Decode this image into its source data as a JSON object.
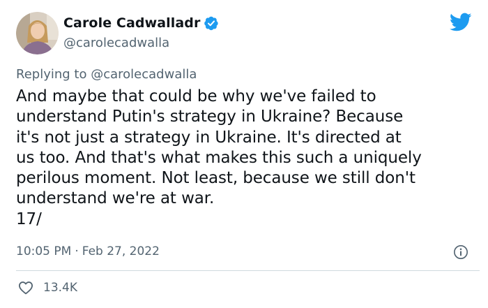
{
  "author": {
    "name": "Carole Cadwalladr",
    "handle": "@carolecadwalla"
  },
  "reply": {
    "prefix": "Replying to",
    "mention": "@carolecadwalla"
  },
  "tweet": {
    "text": "And maybe that could be why we've failed to\nunderstand Putin's strategy in Ukraine? Because\nit's not just a strategy in Ukraine. It's directed at\nus too. And that's what makes this such a uniquely\nperilous moment. Not least, because we still don't\nunderstand we're at war.\n17/",
    "time": "10:05 PM",
    "separator": "·",
    "date": "Feb 27, 2022"
  },
  "stats": {
    "likes": "13.4K"
  },
  "icons": {
    "verified": "verified-badge-icon",
    "brand": "twitter-bird-icon",
    "info": "info-icon",
    "like": "heart-icon"
  },
  "colors": {
    "brand": "#1d9bf0",
    "text": "#0f1419",
    "secondary": "#536471",
    "divider": "#cfd9de"
  }
}
